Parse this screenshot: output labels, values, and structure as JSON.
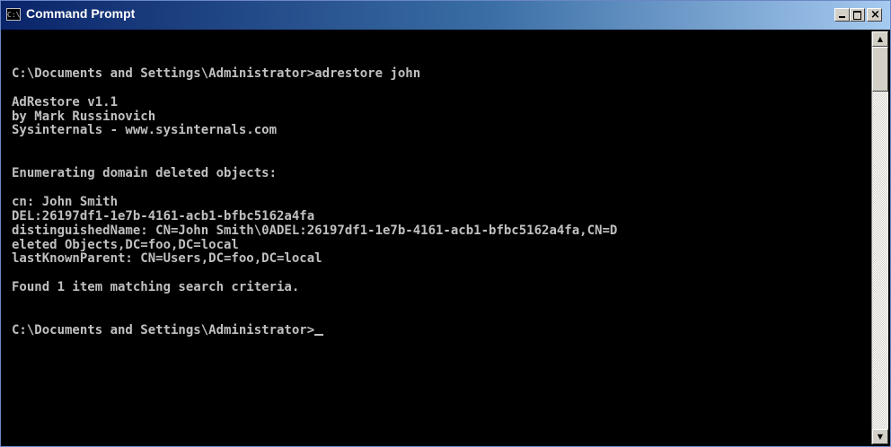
{
  "window": {
    "title": "Command Prompt",
    "icon": "command-prompt-icon",
    "title_icon_glyph": "C:\\"
  },
  "controls": {
    "minimize_icon": "minimize-icon",
    "maximize_icon": "maximize-icon",
    "close_icon": "close-icon",
    "close_glyph": "×"
  },
  "console": {
    "lines": [
      "",
      "C:\\Documents and Settings\\Administrator>adrestore john",
      "",
      "AdRestore v1.1",
      "by Mark Russinovich",
      "Sysinternals - www.sysinternals.com",
      "",
      "",
      "Enumerating domain deleted objects:",
      "",
      "cn: John Smith",
      "DEL:26197df1-1e7b-4161-acb1-bfbc5162a4fa",
      "distinguishedName: CN=John Smith\\0ADEL:26197df1-1e7b-4161-acb1-bfbc5162a4fa,CN=D",
      "eleted Objects,DC=foo,DC=local",
      "lastKnownParent: CN=Users,DC=foo,DC=local",
      "",
      "Found 1 item matching search criteria.",
      "",
      "",
      "C:\\Documents and Settings\\Administrator>"
    ],
    "text_color": "#c0c0c0",
    "background_color": "#000000"
  },
  "scrollbar": {
    "up_glyph": "▲",
    "down_glyph": "▼",
    "up_icon": "scroll-up-arrow-icon",
    "down_icon": "scroll-down-arrow-icon"
  }
}
